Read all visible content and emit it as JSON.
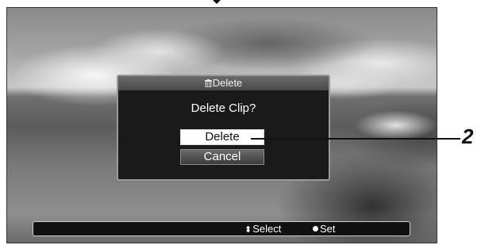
{
  "dialog": {
    "title": "Delete",
    "question": "Delete Clip?",
    "delete_label": "Delete",
    "cancel_label": "Cancel"
  },
  "footer": {
    "select_label": "Select",
    "set_label": "Set"
  },
  "callout": {
    "number": "2"
  },
  "icons": {
    "title": "trash-icon",
    "select": "up-down-arrow-icon",
    "set": "dot-icon"
  }
}
